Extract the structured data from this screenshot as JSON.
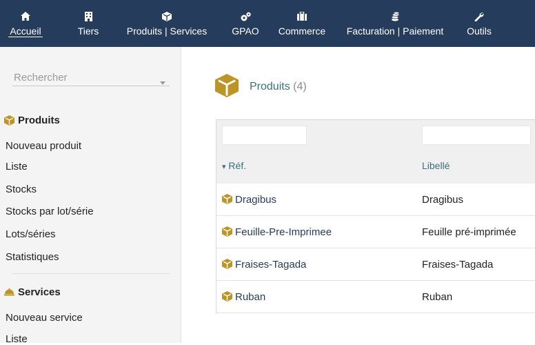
{
  "nav": [
    {
      "label": "Accueil",
      "icon": "home-icon",
      "active": true
    },
    {
      "label": "Tiers",
      "icon": "building-icon"
    },
    {
      "label": "Produits | Services",
      "icon": "cube-icon"
    },
    {
      "label": "GPAO",
      "icon": "cogs-icon"
    },
    {
      "label": "Commerce",
      "icon": "briefcase-icon"
    },
    {
      "label": "Facturation | Paiement",
      "icon": "coins-icon"
    },
    {
      "label": "Outils",
      "icon": "wrench-icon"
    }
  ],
  "sidebar": {
    "search_placeholder": "Rechercher",
    "products": {
      "title": "Produits",
      "links": [
        "Nouveau produit",
        "Liste",
        "Stocks",
        "Stocks par lot/série",
        "Lots/séries",
        "Statistiques"
      ]
    },
    "services": {
      "title": "Services",
      "links": [
        "Nouveau service",
        "Liste"
      ]
    }
  },
  "main": {
    "title": "Produits",
    "count": "(4)",
    "columns": {
      "ref": "Réf.",
      "label": "Libellé"
    },
    "sort_indicator": "▾",
    "rows": [
      {
        "ref": "Dragibus",
        "label": "Dragibus"
      },
      {
        "ref": "Feuille-Pre-Imprimee",
        "label": "Feuille pré-imprimée"
      },
      {
        "ref": "Fraises-Tagada",
        "label": "Fraises-Tagada"
      },
      {
        "ref": "Ruban",
        "label": "Ruban"
      }
    ]
  },
  "colors": {
    "topbar": "#263c5c",
    "accent": "#38707d",
    "cube": "#bc9526"
  }
}
